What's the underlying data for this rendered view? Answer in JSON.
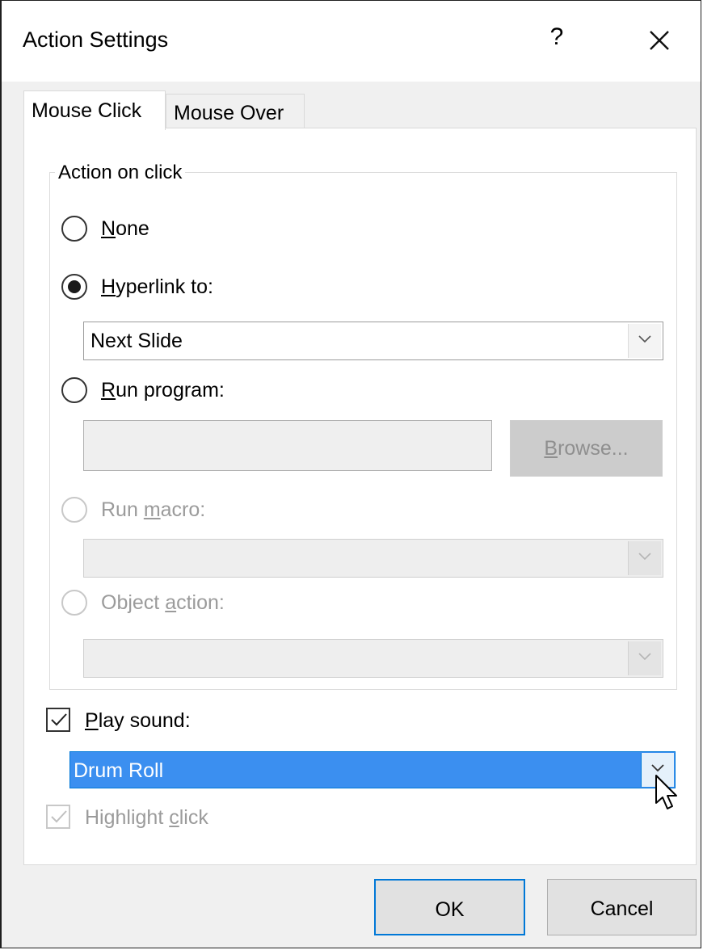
{
  "window": {
    "title": "Action Settings",
    "help_label": "?"
  },
  "tabs": [
    {
      "label": "Mouse Click",
      "active": true
    },
    {
      "label": "Mouse Over",
      "active": false
    }
  ],
  "action_group": {
    "legend": "Action on click",
    "none": {
      "accel": "N",
      "rest": "one",
      "selected": false
    },
    "hyperlink": {
      "accel": "H",
      "rest": "yperlink to:",
      "selected": true,
      "value": "Next Slide"
    },
    "run_program": {
      "accel": "R",
      "rest": "un program:",
      "selected": false,
      "path_value": "",
      "browse_accel": "B",
      "browse_rest": "rowse..."
    },
    "run_macro": {
      "before": "Run ",
      "accel": "m",
      "rest": "acro:",
      "enabled": false,
      "value": ""
    },
    "object_action": {
      "before": "Object ",
      "accel": "a",
      "rest": "ction:",
      "enabled": false,
      "value": ""
    }
  },
  "play_sound": {
    "accel": "P",
    "rest": "lay sound:",
    "checked": true,
    "value": "Drum Roll"
  },
  "highlight_click": {
    "before": "Highlight ",
    "accel": "c",
    "rest": "lick",
    "checked": true,
    "enabled": false
  },
  "footer": {
    "ok_label": "OK",
    "cancel_label": "Cancel"
  },
  "colors": {
    "accent": "#0078d7",
    "selection": "#3b8ff0",
    "dialog_bg": "#f0f0f0"
  }
}
